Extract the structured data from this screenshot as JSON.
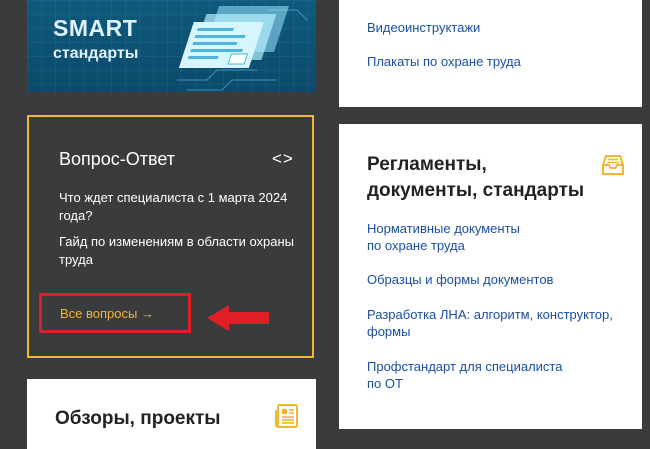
{
  "banner": {
    "title": "SMART",
    "subtitle": "стандарты",
    "bg_color": "#0f5a7d"
  },
  "top_card": {
    "links": [
      "Видеоинструктажи",
      "Плакаты по охране труда"
    ]
  },
  "qa": {
    "title": "Вопрос-Ответ",
    "arrows": "<>",
    "questions": [
      "Что ждет специалиста с 1 марта 2024 года?",
      "Гайд по изменениям в области охраны труда"
    ],
    "all_label": "Все вопросы →",
    "border_color": "#f2b632",
    "highlight_color": "#e01e26"
  },
  "reviews": {
    "title": "Обзоры, проекты",
    "icon": "newspaper-icon"
  },
  "regs": {
    "title": "Регламенты, документы, стандарты",
    "icon": "inbox-tray-icon",
    "links": [
      "Нормативные документы по охране труда",
      "Образцы и формы документов",
      "Разработка ЛНА: алгоритм, конструктор, формы",
      "Профстандарт для специалиста по ОТ"
    ]
  },
  "colors": {
    "page_bg": "#3a3b3d",
    "link": "#1a4fa0",
    "accent": "#f2b632"
  }
}
